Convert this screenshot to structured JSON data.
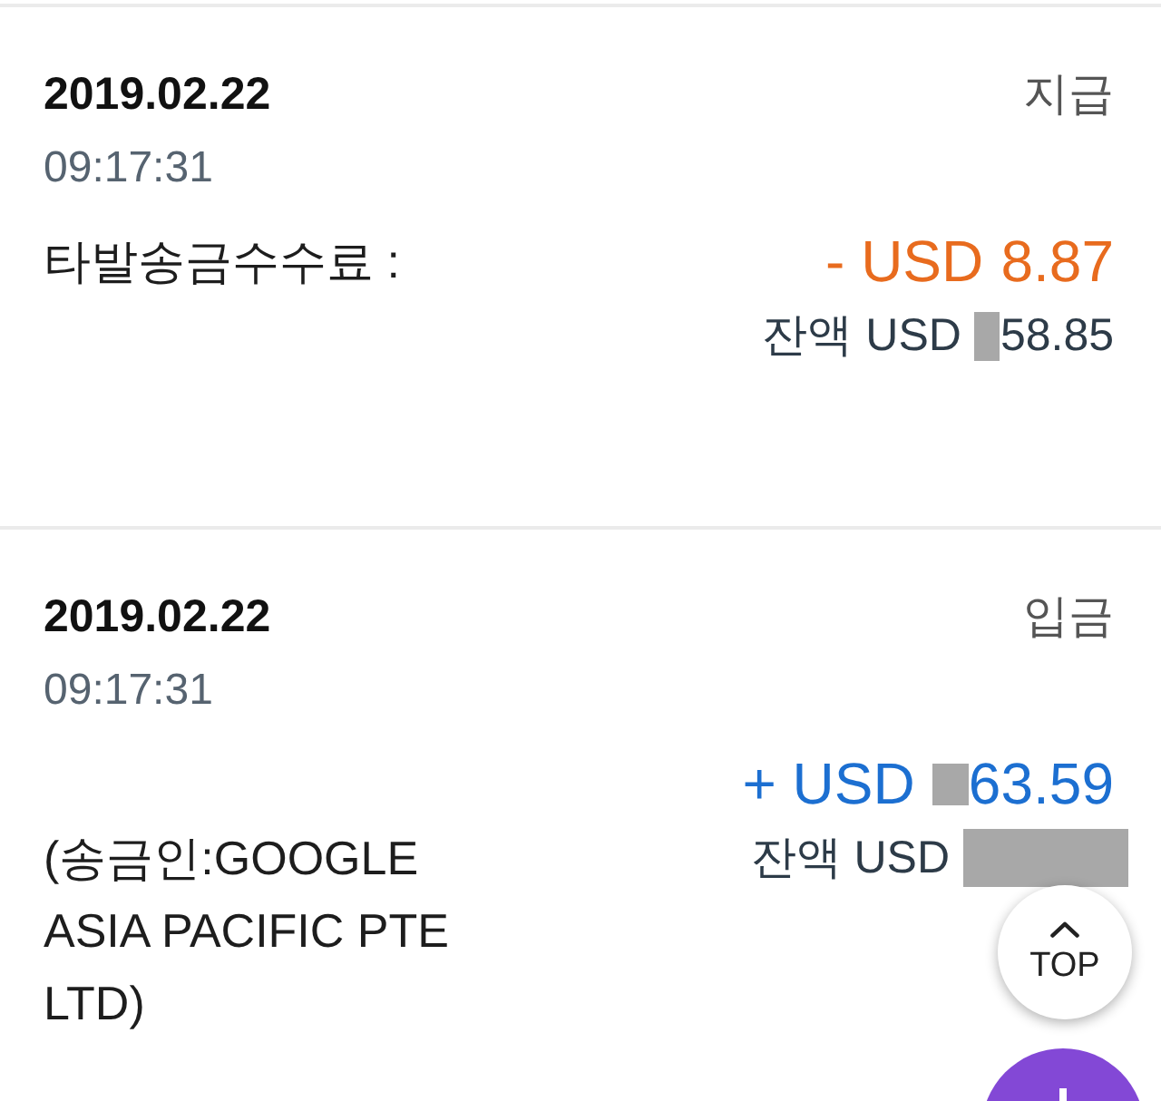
{
  "transactions": [
    {
      "kind": "withdrawal",
      "date": "2019.02.22",
      "time": "09:17:31",
      "type_label": "지급",
      "description": "타발송금수수료 :",
      "amount": {
        "currency": "- USD",
        "redacted": false,
        "value": "8.87"
      },
      "balance": {
        "label": "잔액 USD",
        "redacted": true,
        "value": "58.85"
      }
    },
    {
      "kind": "deposit",
      "date": "2019.02.22",
      "time": "09:17:31",
      "type_label": "입금",
      "description": "(송금인:GOOGLE ASIA PACIFIC PTE LTD)",
      "amount": {
        "currency": "+ USD",
        "redacted": true,
        "value": "63.59"
      },
      "balance": {
        "label": "잔액 USD",
        "redacted": true
      }
    }
  ],
  "top_button": {
    "label": "TOP"
  }
}
